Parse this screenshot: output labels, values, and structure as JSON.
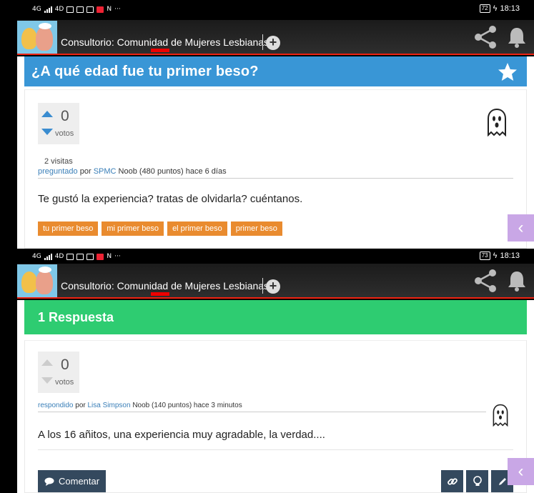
{
  "screens": {
    "question": {
      "status": {
        "battery": "72",
        "time": "18:13",
        "network": "4G",
        "network2": "4D",
        "more": "···"
      },
      "appbar": {
        "title": "Consultorio: Comunidad de Mujeres Lesbianas"
      },
      "question": {
        "title": "¿A qué edad fue tu primer beso?",
        "votes": "0",
        "votes_label": "votos",
        "visits": "2 visitas",
        "meta": {
          "action": "preguntado",
          "by": "por",
          "user": "SPMC",
          "rank": "Noob (480 puntos) hace 6 días"
        },
        "body": "Te gustó la experiencia? tratas de olvidarla? cuéntanos.",
        "tags": [
          "tu primer beso",
          "mi primer beso",
          "el primer beso",
          "primer beso"
        ]
      }
    },
    "answer": {
      "status": {
        "battery": "73",
        "time": "18:13",
        "network": "4G",
        "network2": "4D",
        "more": "···"
      },
      "appbar": {
        "title": "Consultorio: Comunidad de Mujeres Lesbianas"
      },
      "answers_header": "1 Respuesta",
      "answer": {
        "votes": "0",
        "votes_label": "votos",
        "meta": {
          "action": "respondido",
          "by": "por",
          "user": "Lisa Simpson",
          "rank": "Noob (140 puntos) hace 3 minutos"
        },
        "body": "A los 16 añitos, una experiencia muy agradable, la verdad....",
        "comment_label": "Comentar"
      }
    }
  },
  "colors": {
    "question_header": "#3996d6",
    "answer_header": "#2ecc71",
    "tag": "#e98b2f",
    "button": "#34495e",
    "side_tab": "#c9a7e6"
  }
}
